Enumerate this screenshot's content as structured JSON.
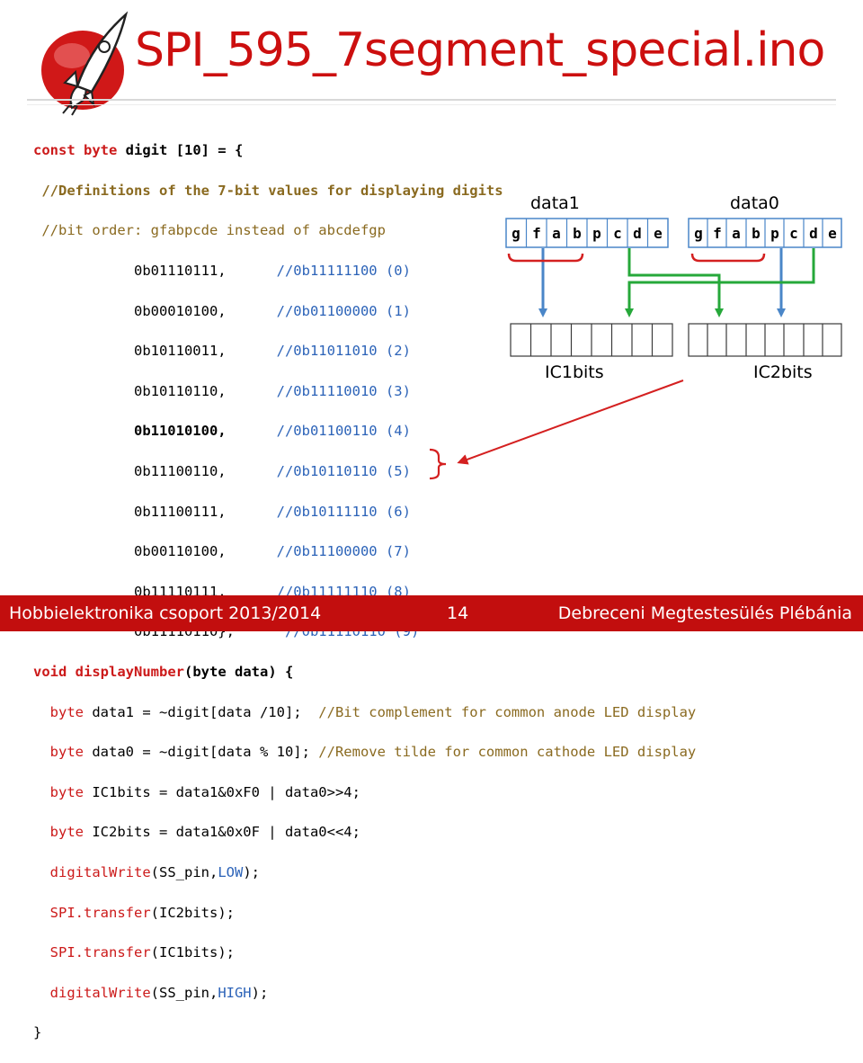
{
  "slide": {
    "title": "SPI_595_7segment_special.ino",
    "colors": {
      "accent": "#c20e0e",
      "title": "#cc0f0f",
      "diagram_blue": "#4a86c8",
      "diagram_green": "#26a83a",
      "diagram_red": "#d42020"
    }
  },
  "code": {
    "array_decl": {
      "keyword": "const byte",
      "rest": " digit [10] = {"
    },
    "comments": [
      "//Definitions of the 7-bit values for displaying digits",
      "//bit order: gfabpcde instead of abcdefgp"
    ],
    "values": [
      {
        "value": "0b01110111,",
        "comment": "//0b11111100 (0)"
      },
      {
        "value": "0b00010100,",
        "comment": "//0b01100000 (1)"
      },
      {
        "value": "0b10110011,",
        "comment": "//0b11011010 (2)"
      },
      {
        "value": "0b10110110,",
        "comment": "//0b11110010 (3)"
      },
      {
        "value": "0b11010100,",
        "comment": "//0b01100110 (4)"
      },
      {
        "value": "0b11100110,",
        "comment": "//0b10110110 (5)"
      },
      {
        "value": "0b11100111,",
        "comment": "//0b10111110 (6)"
      },
      {
        "value": "0b00110100,",
        "comment": "//0b11100000 (7)"
      },
      {
        "value": "0b11110111,",
        "comment": "//0b11111110 (8)"
      },
      {
        "value": "0b11110110};",
        "comment": "//0b11110110 (9)"
      }
    ],
    "func_decl": {
      "keyword": "void",
      "name": "displayNumber",
      "rest": "(byte data) {"
    },
    "lines": [
      {
        "kw": "byte",
        "text": " data1 = ~digit[data /10];  ",
        "comment": "//Bit complement for common anode LED display"
      },
      {
        "kw": "byte",
        "text": " data0 = ~digit[data % 10]; ",
        "comment": "//Remove tilde for common cathode LED display"
      },
      {
        "kw": "byte",
        "text": " IC1bits = data1&0xF0 | data0>>4;"
      },
      {
        "kw": "byte",
        "text": " IC2bits = data1&0x0F | data0<<4;"
      }
    ],
    "calls": {
      "dw1_fn": "digitalWrite",
      "dw1_args_a": "(SS_pin,",
      "dw1_const": "LOW",
      "dw1_args_b": ");",
      "spi1_obj": "SPI",
      "spi1_fn": ".transfer",
      "spi1_args": "(IC2bits);",
      "spi2_obj": "SPI",
      "spi2_fn": ".transfer",
      "spi2_args": "(IC1bits);",
      "dw2_fn": "digitalWrite",
      "dw2_args_a": "(SS_pin,",
      "dw2_const": "HIGH",
      "dw2_args_b": ");"
    },
    "closing_brace": "}"
  },
  "diagram": {
    "data1_label": "data1",
    "data0_label": "data0",
    "data1_bits": [
      "g",
      "f",
      "a",
      "b",
      "p",
      "c",
      "d",
      "e"
    ],
    "data0_bits": [
      "g",
      "f",
      "a",
      "b",
      "p",
      "c",
      "d",
      "e"
    ],
    "ic1_label": "IC1bits",
    "ic2_label": "IC2bits"
  },
  "footer": {
    "left": "Hobbielektronika csoport 2013/2014",
    "page": "14",
    "right": "Debreceni Megtestesülés Plébánia"
  }
}
